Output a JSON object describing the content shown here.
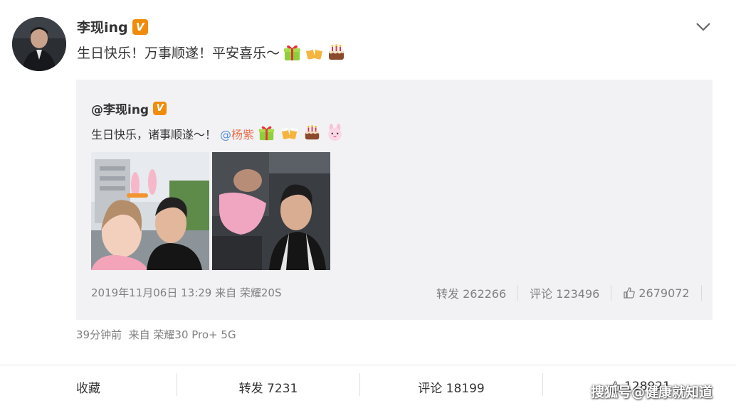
{
  "post": {
    "author_name": "李现ing",
    "verified_badge": "V",
    "text": "生日快乐！万事顺遂！平安喜乐～",
    "emojis": [
      "gift-emoji",
      "cheers-emoji",
      "cake-emoji"
    ],
    "time": "39分钟前",
    "source": "来自 荣耀30 Pro+ 5G"
  },
  "repost": {
    "author_name": "@李现ing",
    "verified_badge": "V",
    "text": "生日快乐，诸事顺遂～！",
    "mention_at": "@",
    "mention_name": "杨紫",
    "emojis": [
      "gift-emoji",
      "cheers-emoji",
      "cake-emoji",
      "pink-rabbit-emoji"
    ],
    "date": "2019年11月06日 13:29",
    "source": "来自 荣耀20S",
    "actions": {
      "repost": "转发 262266",
      "comment": "评论 123496",
      "like": "2679072"
    }
  },
  "footer": {
    "favorite": "收藏",
    "repost": "转发 7231",
    "comment": "评论 18199",
    "like": "128921"
  },
  "watermark": "搜狐号@健康就知道",
  "colors": {
    "badge": "#f08b0b",
    "repost_bg": "#f2f2f5",
    "meta": "#808080",
    "mention": "#eb7350",
    "link": "#5a8fcb"
  }
}
